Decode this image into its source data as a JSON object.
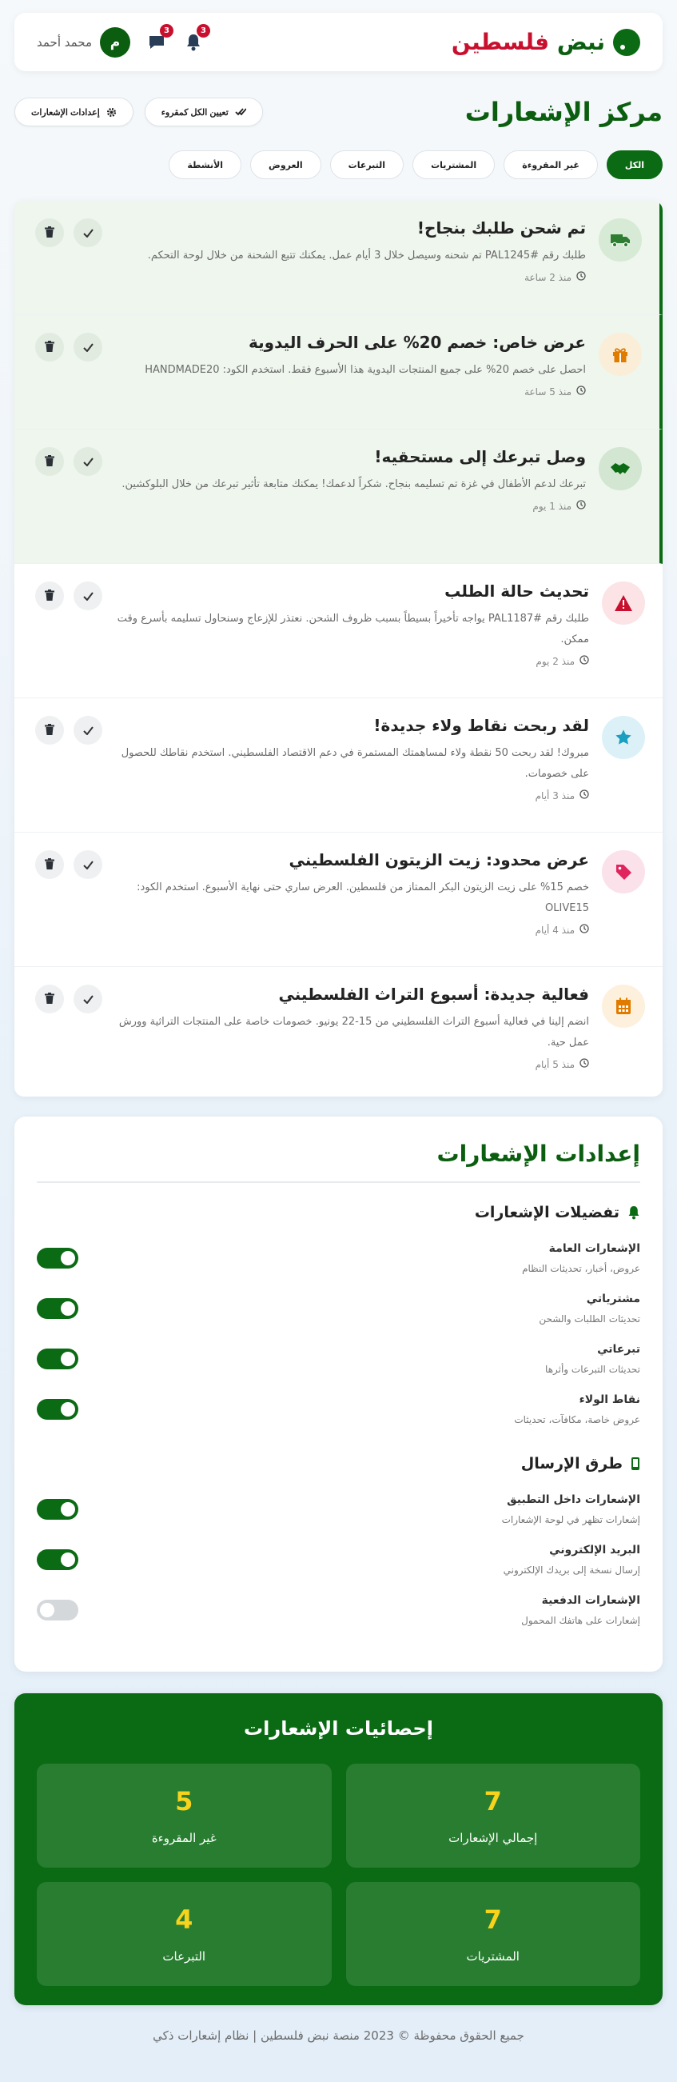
{
  "header": {
    "brand_main": "نبض",
    "brand_accent": "فلسطين",
    "user_name": "محمد أحمد",
    "avatar_letter": "م",
    "messages_badge": "3",
    "bell_badge": "3",
    "icons": [
      "bell-icon",
      "message-icon"
    ]
  },
  "page": {
    "title": "مركز الإشعارات",
    "mark_all_read": "تعيين الكل كمقروء",
    "settings_btn": "إعدادات الإشعارات"
  },
  "tabs": [
    "الكل",
    "غير المقروءة",
    "المشتريات",
    "التبرعات",
    "العروض",
    "الأنشطة"
  ],
  "notifications": [
    {
      "title": "تم شحن طلبك بنجاح!",
      "text": "طلبك رقم #PAL1245 تم شحنه وسيصل خلال 3 أيام عمل. يمكنك تتبع الشحنة من خلال لوحة التحكم.",
      "time": "منذ 2 ساعة",
      "icon": "truck-icon",
      "unread": true,
      "color": "#2e7d32",
      "bg": "#d7ead5"
    },
    {
      "title": "عرض خاص: خصم 20% على الحرف اليدوية",
      "text": "احصل على خصم 20% على جميع المنتجات اليدوية هذا الأسبوع فقط. استخدم الكود: HANDMADE20",
      "time": "منذ 5 ساعة",
      "icon": "gift-icon",
      "unread": true,
      "color": "#e07b00",
      "bg": "#fbeed8"
    },
    {
      "title": "وصل تبرعك إلى مستحقيه!",
      "text": "تبرعك لدعم الأطفال في غزة تم تسليمه بنجاح. شكراً لدعمك! يمكنك متابعة تأثير تبرعك من خلال البلوكشين.",
      "time": "منذ 1 يوم",
      "icon": "handshake-icon",
      "unread": true,
      "color": "#0b6b14",
      "bg": "#d3e6d1"
    },
    {
      "title": "تحديث حالة الطلب",
      "text": "طلبك رقم #PAL1187 يواجه تأخيراً بسيطاً بسبب ظروف الشحن. نعتذر للإزعاج وسنحاول تسليمه بأسرع وقت ممكن.",
      "time": "منذ 2 يوم",
      "icon": "warning-icon",
      "unread": false,
      "color": "#c8102e",
      "bg": "#fbe3e6"
    },
    {
      "title": "لقد ربحت نقاط ولاء جديدة!",
      "text": "مبروك! لقد ربحت 50 نقطة ولاء لمساهمتك المستمرة في دعم الاقتصاد الفلسطيني. استخدم نقاطك للحصول على خصومات.",
      "time": "منذ 3 أيام",
      "icon": "star-icon",
      "unread": false,
      "color": "#1a9fc0",
      "bg": "#dcf1f7"
    },
    {
      "title": "عرض محدود: زيت الزيتون الفلسطيني",
      "text": "خصم 15% على زيت الزيتون البكر الممتاز من فلسطين. العرض ساري حتى نهاية الأسبوع. استخدم الكود: OLIVE15",
      "time": "منذ 4 أيام",
      "icon": "tag-icon",
      "unread": false,
      "color": "#e0245e",
      "bg": "#fbe1e9"
    },
    {
      "title": "فعالية جديدة: أسبوع التراث الفلسطيني",
      "text": "انضم إلينا في فعالية أسبوع التراث الفلسطيني من 15-22 يونيو. خصومات خاصة على المنتجات التراثية وورش عمل حية.",
      "time": "منذ 5 أيام",
      "icon": "calendar-icon",
      "unread": false,
      "color": "#e07b00",
      "bg": "#fdf0dc"
    }
  ],
  "settings": {
    "title": "إعدادات الإشعارات",
    "preferences_title": "تفضيلات الإشعارات",
    "preferences": [
      {
        "label": "الإشعارات العامة",
        "desc": "عروض، أخبار، تحديثات النظام",
        "on": true
      },
      {
        "label": "مشترياتي",
        "desc": "تحديثات الطلبات والشحن",
        "on": true
      },
      {
        "label": "تبرعاتي",
        "desc": "تحديثات التبرعات وأثرها",
        "on": true
      },
      {
        "label": "نقاط الولاء",
        "desc": "عروض خاصة، مكافآت، تحديثات",
        "on": true
      }
    ],
    "methods_title": "طرق الإرسال",
    "methods": [
      {
        "label": "الإشعارات داخل التطبيق",
        "desc": "إشعارات تظهر في لوحة الإشعارات",
        "on": true
      },
      {
        "label": "البريد الإلكتروني",
        "desc": "إرسال نسخة إلى بريدك الإلكتروني",
        "on": true
      },
      {
        "label": "الإشعارات الدفعية",
        "desc": "إشعارات على هاتفك المحمول",
        "on": false
      }
    ]
  },
  "stats": {
    "title": "إحصائيات الإشعارات",
    "items": [
      {
        "value": "7",
        "label": "إجمالي الإشعارات"
      },
      {
        "value": "5",
        "label": "غير المقروءة"
      },
      {
        "value": "7",
        "label": "المشتريات"
      },
      {
        "value": "4",
        "label": "التبرعات"
      }
    ]
  },
  "footer": "جميع الحقوق محفوظة © 2023 منصة نبض فلسطين | نظام إشعارات ذكي",
  "colors": {
    "primary": "#0b6b14",
    "accent": "#c8102e",
    "stat_number": "#f7d31b"
  }
}
